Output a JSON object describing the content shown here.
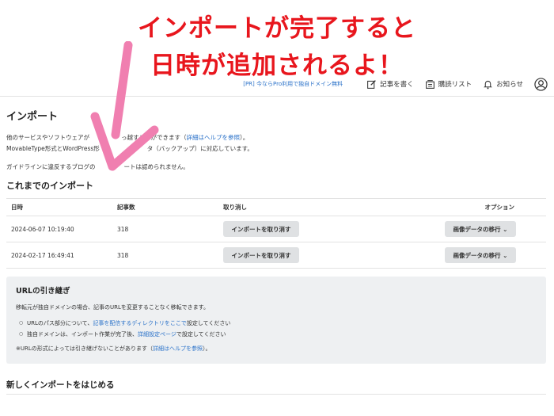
{
  "annotation": {
    "line1": "インポートが完了すると",
    "line2": "日時が追加されるよ！",
    "color": "#e8161d",
    "arrow_color": "#f07fb0"
  },
  "header": {
    "promo": "[PR] 今ならPro利用で独自ドメイン無料",
    "write": "記事を書く",
    "reading_list": "購読リスト",
    "notifications": "お知らせ",
    "link_color": "#2b72c9"
  },
  "page": {
    "title": "インポート",
    "intro_line1_pre": "他のサービスやソフトウェアが",
    "intro_line1_mid": "っ越すことができます（",
    "intro_line1_link": "詳細はヘルプを参照",
    "intro_line1_post": "）。",
    "intro_line2_pre": "MovableType形式とWordPress形",
    "intro_line2_post": "タ（バックアップ）に対応しています。",
    "guideline_link": "ガイドライン",
    "guideline_pre": "に違反するブログの",
    "guideline_post": "ートは認められません。"
  },
  "history": {
    "heading": "これまでのインポート",
    "columns": {
      "date": "日時",
      "count": "記事数",
      "cancel": "取り消し",
      "option": "オプション"
    },
    "rows": [
      {
        "date": "2024-06-07 10:19:40",
        "count": "318",
        "cancel_label": "インポートを取り消す",
        "option_label": "画像データの移行"
      },
      {
        "date": "2024-02-17 16:49:41",
        "count": "318",
        "cancel_label": "インポートを取り消す",
        "option_label": "画像データの移行"
      }
    ]
  },
  "url_box": {
    "title": "URLの引き継ぎ",
    "desc": "移転元が独自ドメインの場合、記事のURLを変更することなく移転できます。",
    "item1_pre": "URLのパス部分について、",
    "item1_link": "記事を配信するディレクトリをここで",
    "item1_post": "設定してください",
    "item2_pre": "独自ドメインは、インポート作業が完了後、",
    "item2_link": "詳細設定ページ",
    "item2_post": "で設定してください",
    "note_pre": "※URLの形式によっては引き継げないことがあります（",
    "note_link": "詳細はヘルプを参照",
    "note_post": "）。"
  },
  "new_import": {
    "heading": "新しくインポートをはじめる"
  }
}
